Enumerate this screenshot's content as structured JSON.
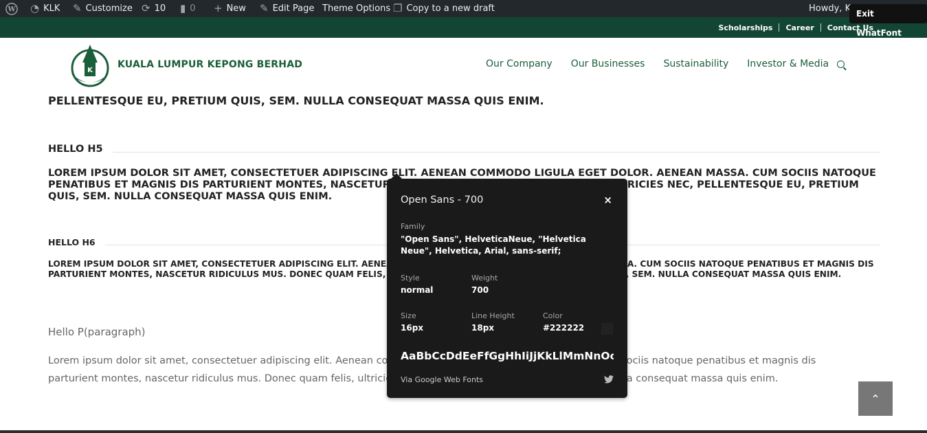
{
  "admin_bar": {
    "site_name": "KLK",
    "customize": "Customize",
    "updates_count": "10",
    "comments_count": "0",
    "new_label": "New",
    "edit_page": "Edit Page",
    "theme_options": "Theme Options",
    "copy_draft": "Copy to a new draft",
    "howdy": "Howdy, KLK Admin",
    "exit_whatfont": "Exit WhatFont"
  },
  "top_links": [
    "Scholarships",
    "Career",
    "Contact Us"
  ],
  "header": {
    "logo_text": "KUALA LUMPUR KEPONG BERHAD",
    "nav": [
      "Our Company",
      "Our Businesses",
      "Sustainability",
      "Investor & Media"
    ]
  },
  "content": {
    "h4_tail": "PELLENTESQUE EU, PRETIUM QUIS, SEM. NULLA CONSEQUAT MASSA QUIS ENIM.",
    "h5_title": "HELLO H5",
    "h5_text": "LOREM IPSUM DOLOR SIT AMET, CONSECTETUER ADIPISCING ELIT. AENEAN COMMODO LIGULA EGET DOLOR. AENEAN MASSA. CUM SOCIIS NATOQUE PENATIBUS ET MAGNIS DIS PARTURIENT MONTES, NASCETUR RIDICULUS MUS. DONEC QUAM FELIS, ULTRICIES NEC, PELLENTESQUE EU, PRETIUM QUIS, SEM. NULLA CONSEQUAT MASSA QUIS ENIM.",
    "h6_title": "HELLO H6",
    "h6_text": "LOREM IPSUM DOLOR SIT AMET, CONSECTETUER ADIPISCING ELIT. AENEAN COMMODO LIGULA EGET DOLOR. AENEAN MASSA. CUM SOCIIS NATOQUE PENATIBUS ET MAGNIS DIS PARTURIENT MONTES, NASCETUR RIDICULUS MUS. DONEC QUAM FELIS, ULTRICIES NEC, PELLENTESQUE EU, PRETIUM QUIS, SEM. NULLA CONSEQUAT MASSA QUIS ENIM.",
    "p_title": "Hello P(paragraph)",
    "p_text": "Lorem ipsum dolor sit amet, consectetuer adipiscing elit. Aenean commodo ligula eget dolor. Aenean massa. Cum sociis natoque penatibus et magnis dis parturient montes, nascetur ridiculus mus. Donec quam felis, ultricies nec, pellentesque eu, pretium quis, sem. Nulla consequat massa quis enim."
  },
  "whatfont": {
    "title": "Open Sans - 700",
    "close": "×",
    "family_label": "Family",
    "family_value": "\"Open Sans\", HelveticaNeue, \"Helvetica Neue\", Helvetica, Arial, sans-serif;",
    "style_label": "Style",
    "style_value": "normal",
    "weight_label": "Weight",
    "weight_value": "700",
    "size_label": "Size",
    "size_value": "16px",
    "lineheight_label": "Line Height",
    "lineheight_value": "18px",
    "color_label": "Color",
    "color_value": "#222222",
    "sample": "AaBbCcDdEeFfGgHhIiJjKkLlMmNnOoPpQqRrSsTtUuVvWwXxYyZz",
    "via": "Via Google Web Fonts"
  },
  "colors": {
    "brand_green": "#134534",
    "nav_green": "#1b5e3a",
    "admin_bg": "#23282d"
  }
}
